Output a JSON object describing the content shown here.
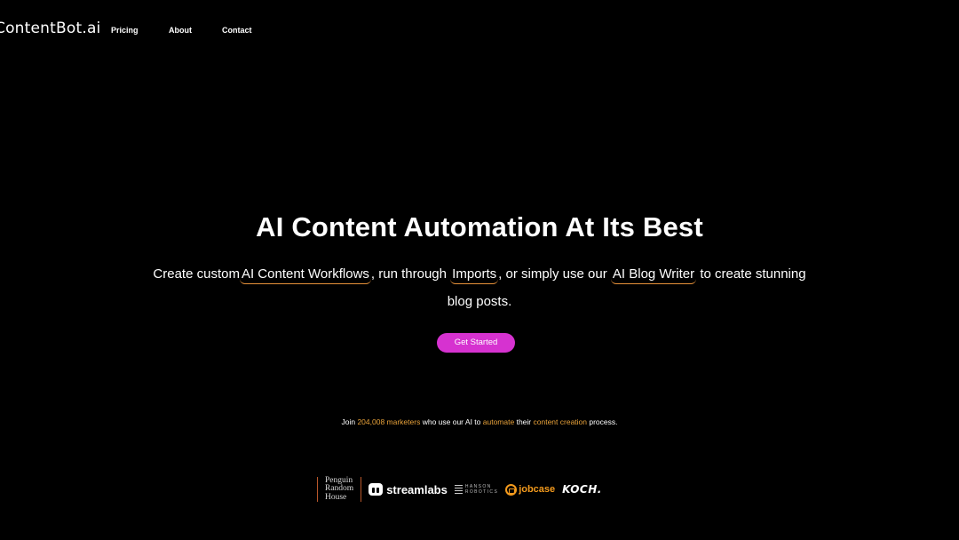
{
  "nav": {
    "logo": "ContentBot.ai",
    "links": [
      {
        "label": "Pricing"
      },
      {
        "label": "About"
      },
      {
        "label": "Contact"
      }
    ]
  },
  "hero": {
    "title": "AI Content Automation At Its Best",
    "sub_part1": "Create custom",
    "link_workflows": "AI Content Workflows",
    "sub_part2": ", run through",
    "link_imports": "Imports",
    "sub_part3": ", or simply use our",
    "link_blog_writer": "AI Blog Writer",
    "sub_part4": "to create stunning blog posts.",
    "cta_label": "Get Started"
  },
  "proof": {
    "part1": "Join",
    "count": "204,008 marketers",
    "part2": "who use our AI to",
    "automate": "automate",
    "part3": "their",
    "content_creation": "content creation",
    "part4": "process."
  },
  "logos": {
    "penguin_line1": "Penguin",
    "penguin_line2": "Random",
    "penguin_line3": "House",
    "streamlabs": "streamlabs",
    "hanson_line1": "HANSON",
    "hanson_line2": "ROBOTICS",
    "jobcase": "jobcase",
    "koch": "KOCH."
  },
  "colors": {
    "background": "#000000",
    "cta": "#d632d0",
    "accent": "#e8a23a"
  }
}
